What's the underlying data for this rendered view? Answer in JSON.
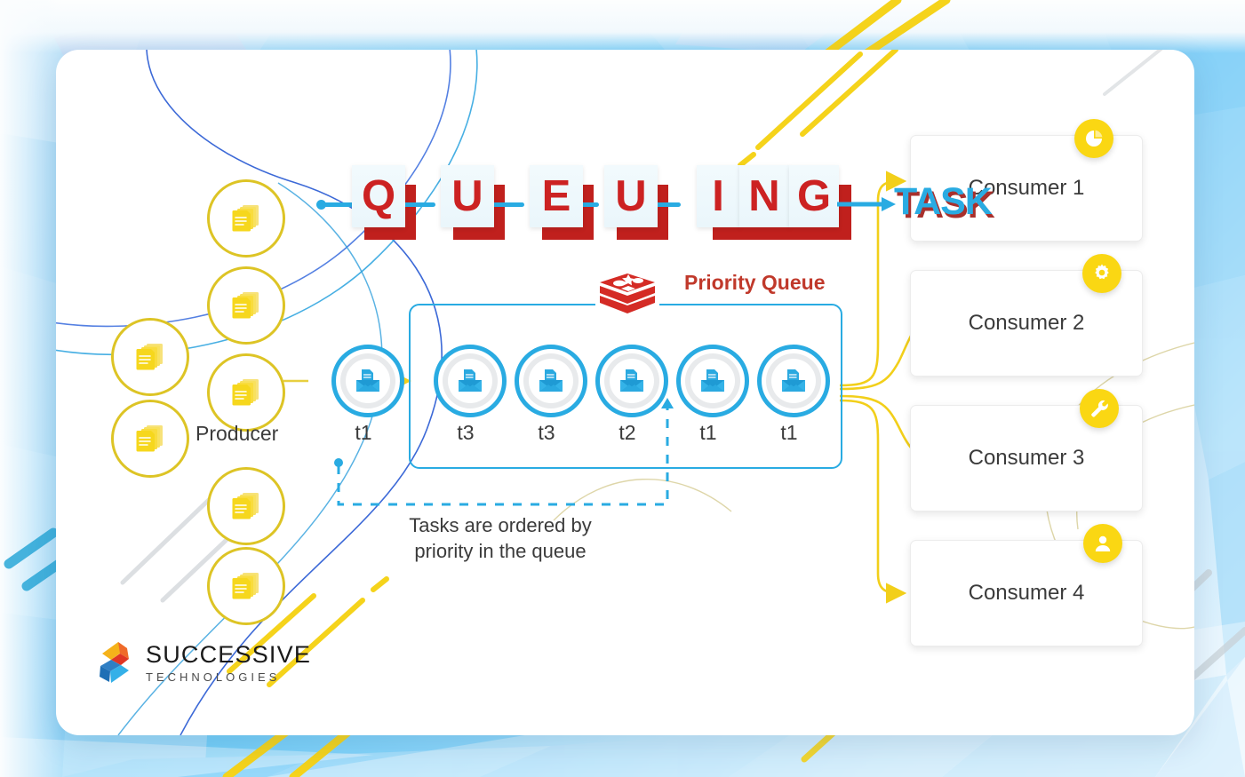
{
  "title": {
    "letters": [
      "Q",
      "U",
      "E",
      "U",
      "I",
      "N",
      "G"
    ],
    "task_word": "TASK"
  },
  "producer": {
    "label": "Producer",
    "icon": "stacked-documents-icon",
    "count": 7
  },
  "queue": {
    "label": "Priority Queue",
    "logo_icon": "redis-logo-icon",
    "inflight_task": {
      "label": "t1",
      "icon": "envelope-document-icon"
    },
    "tasks": [
      {
        "label": "t3",
        "icon": "envelope-document-icon"
      },
      {
        "label": "t3",
        "icon": "envelope-document-icon"
      },
      {
        "label": "t2",
        "icon": "envelope-document-icon"
      },
      {
        "label": "t1",
        "icon": "envelope-document-icon"
      },
      {
        "label": "t1",
        "icon": "envelope-document-icon"
      }
    ],
    "caption_line1": "Tasks are ordered by",
    "caption_line2": "priority in the queue"
  },
  "consumers": [
    {
      "label": "Consumer 1",
      "icon": "pie-chart-icon"
    },
    {
      "label": "Consumer 2",
      "icon": "gear-icon"
    },
    {
      "label": "Consumer 3",
      "icon": "wrench-icon"
    },
    {
      "label": "Consumer 4",
      "icon": "user-icon"
    }
  ],
  "logo": {
    "name": "SUCCESSIVE",
    "subtitle": "TECHNOLOGIES",
    "mark": "successive-logo-mark"
  },
  "colors": {
    "accent_blue": "#29ABE2",
    "accent_yellow": "#FAD713",
    "producer_yellow": "#ddc425",
    "red": "#c0392b",
    "letter_red": "#cc2222",
    "shadow_red": "#c0201d",
    "text_dark": "#3b3b3b"
  }
}
